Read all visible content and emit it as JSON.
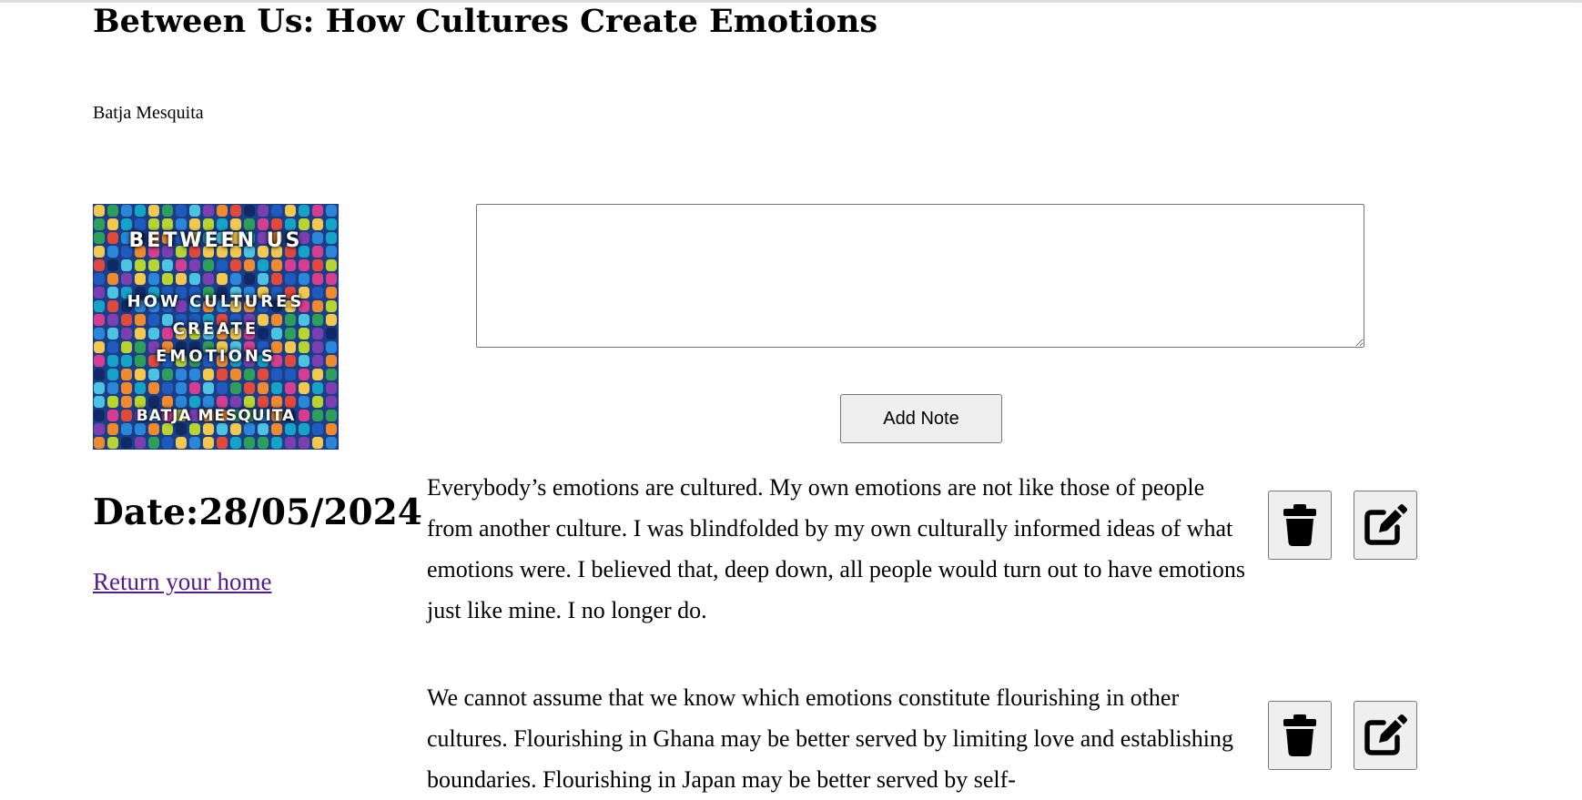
{
  "book": {
    "title": "Between Us: How Cultures Create Emotions",
    "author": "Batja Mesquita",
    "cover": {
      "line1": "BETWEEN US",
      "line2": "HOW CULTURES",
      "line3": "CREATE",
      "line4": "EMOTIONS",
      "line5": "BATJA MESQUITA"
    },
    "date": "Date:28/05/2024",
    "home_link": "Return your home"
  },
  "note_form": {
    "input_value": "",
    "add_label": "Add Note"
  },
  "notes": [
    {
      "text": "Everybody’s emotions are cultured. My own emotions are not like those of people from another culture. I was blindfolded by my own culturally informed ideas of what emotions were. I believed that, deep down, all people would turn out to have emotions just like mine. I no longer do.",
      "delete_icon": "trash-icon",
      "edit_icon": "edit-icon"
    },
    {
      "text": "We cannot assume that we know which emotions constitute flourishing in other cultures. Flourishing in Ghana may be better served by limiting love and establishing boundaries. Flourishing in Japan may be better served by self-",
      "delete_icon": "trash-icon",
      "edit_icon": "edit-icon"
    }
  ]
}
